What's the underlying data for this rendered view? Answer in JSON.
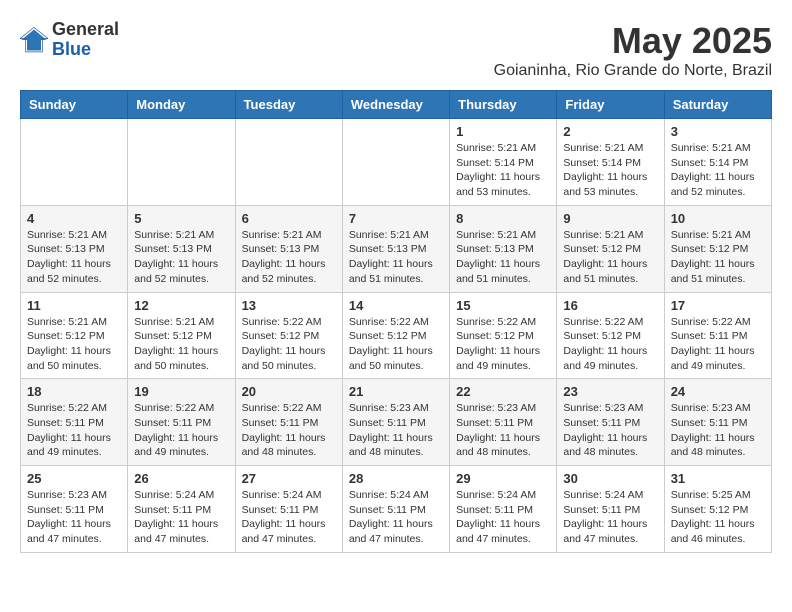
{
  "header": {
    "logo_general": "General",
    "logo_blue": "Blue",
    "month_title": "May 2025",
    "location": "Goianinha, Rio Grande do Norte, Brazil"
  },
  "days_of_week": [
    "Sunday",
    "Monday",
    "Tuesday",
    "Wednesday",
    "Thursday",
    "Friday",
    "Saturday"
  ],
  "weeks": [
    [
      {
        "day": "",
        "info": ""
      },
      {
        "day": "",
        "info": ""
      },
      {
        "day": "",
        "info": ""
      },
      {
        "day": "",
        "info": ""
      },
      {
        "day": "1",
        "info": "Sunrise: 5:21 AM\nSunset: 5:14 PM\nDaylight: 11 hours\nand 53 minutes."
      },
      {
        "day": "2",
        "info": "Sunrise: 5:21 AM\nSunset: 5:14 PM\nDaylight: 11 hours\nand 53 minutes."
      },
      {
        "day": "3",
        "info": "Sunrise: 5:21 AM\nSunset: 5:14 PM\nDaylight: 11 hours\nand 52 minutes."
      }
    ],
    [
      {
        "day": "4",
        "info": "Sunrise: 5:21 AM\nSunset: 5:13 PM\nDaylight: 11 hours\nand 52 minutes."
      },
      {
        "day": "5",
        "info": "Sunrise: 5:21 AM\nSunset: 5:13 PM\nDaylight: 11 hours\nand 52 minutes."
      },
      {
        "day": "6",
        "info": "Sunrise: 5:21 AM\nSunset: 5:13 PM\nDaylight: 11 hours\nand 52 minutes."
      },
      {
        "day": "7",
        "info": "Sunrise: 5:21 AM\nSunset: 5:13 PM\nDaylight: 11 hours\nand 51 minutes."
      },
      {
        "day": "8",
        "info": "Sunrise: 5:21 AM\nSunset: 5:13 PM\nDaylight: 11 hours\nand 51 minutes."
      },
      {
        "day": "9",
        "info": "Sunrise: 5:21 AM\nSunset: 5:12 PM\nDaylight: 11 hours\nand 51 minutes."
      },
      {
        "day": "10",
        "info": "Sunrise: 5:21 AM\nSunset: 5:12 PM\nDaylight: 11 hours\nand 51 minutes."
      }
    ],
    [
      {
        "day": "11",
        "info": "Sunrise: 5:21 AM\nSunset: 5:12 PM\nDaylight: 11 hours\nand 50 minutes."
      },
      {
        "day": "12",
        "info": "Sunrise: 5:21 AM\nSunset: 5:12 PM\nDaylight: 11 hours\nand 50 minutes."
      },
      {
        "day": "13",
        "info": "Sunrise: 5:22 AM\nSunset: 5:12 PM\nDaylight: 11 hours\nand 50 minutes."
      },
      {
        "day": "14",
        "info": "Sunrise: 5:22 AM\nSunset: 5:12 PM\nDaylight: 11 hours\nand 50 minutes."
      },
      {
        "day": "15",
        "info": "Sunrise: 5:22 AM\nSunset: 5:12 PM\nDaylight: 11 hours\nand 49 minutes."
      },
      {
        "day": "16",
        "info": "Sunrise: 5:22 AM\nSunset: 5:12 PM\nDaylight: 11 hours\nand 49 minutes."
      },
      {
        "day": "17",
        "info": "Sunrise: 5:22 AM\nSunset: 5:11 PM\nDaylight: 11 hours\nand 49 minutes."
      }
    ],
    [
      {
        "day": "18",
        "info": "Sunrise: 5:22 AM\nSunset: 5:11 PM\nDaylight: 11 hours\nand 49 minutes."
      },
      {
        "day": "19",
        "info": "Sunrise: 5:22 AM\nSunset: 5:11 PM\nDaylight: 11 hours\nand 49 minutes."
      },
      {
        "day": "20",
        "info": "Sunrise: 5:22 AM\nSunset: 5:11 PM\nDaylight: 11 hours\nand 48 minutes."
      },
      {
        "day": "21",
        "info": "Sunrise: 5:23 AM\nSunset: 5:11 PM\nDaylight: 11 hours\nand 48 minutes."
      },
      {
        "day": "22",
        "info": "Sunrise: 5:23 AM\nSunset: 5:11 PM\nDaylight: 11 hours\nand 48 minutes."
      },
      {
        "day": "23",
        "info": "Sunrise: 5:23 AM\nSunset: 5:11 PM\nDaylight: 11 hours\nand 48 minutes."
      },
      {
        "day": "24",
        "info": "Sunrise: 5:23 AM\nSunset: 5:11 PM\nDaylight: 11 hours\nand 48 minutes."
      }
    ],
    [
      {
        "day": "25",
        "info": "Sunrise: 5:23 AM\nSunset: 5:11 PM\nDaylight: 11 hours\nand 47 minutes."
      },
      {
        "day": "26",
        "info": "Sunrise: 5:24 AM\nSunset: 5:11 PM\nDaylight: 11 hours\nand 47 minutes."
      },
      {
        "day": "27",
        "info": "Sunrise: 5:24 AM\nSunset: 5:11 PM\nDaylight: 11 hours\nand 47 minutes."
      },
      {
        "day": "28",
        "info": "Sunrise: 5:24 AM\nSunset: 5:11 PM\nDaylight: 11 hours\nand 47 minutes."
      },
      {
        "day": "29",
        "info": "Sunrise: 5:24 AM\nSunset: 5:11 PM\nDaylight: 11 hours\nand 47 minutes."
      },
      {
        "day": "30",
        "info": "Sunrise: 5:24 AM\nSunset: 5:11 PM\nDaylight: 11 hours\nand 47 minutes."
      },
      {
        "day": "31",
        "info": "Sunrise: 5:25 AM\nSunset: 5:12 PM\nDaylight: 11 hours\nand 46 minutes."
      }
    ]
  ]
}
